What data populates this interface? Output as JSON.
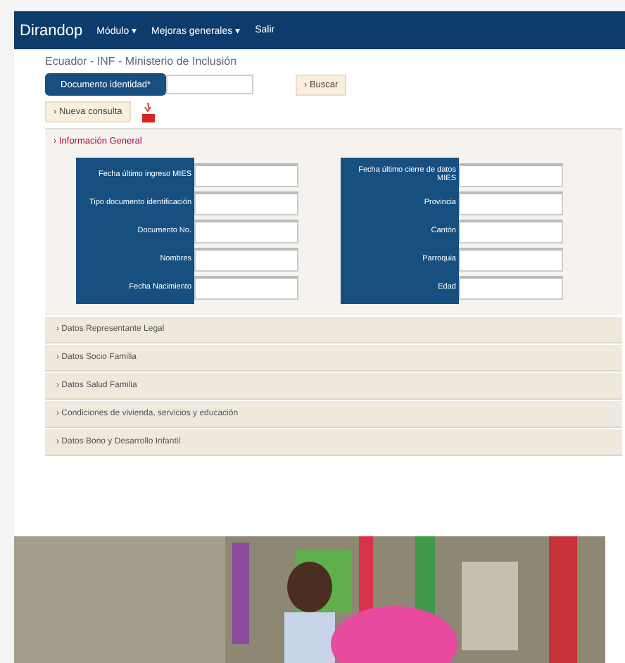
{
  "navbar": {
    "brand": "Dirandop",
    "menu": [
      {
        "label": "Módulo ▾"
      },
      {
        "label": "Mejoras generales ▾"
      },
      {
        "label": "Salir"
      }
    ]
  },
  "breadcrumb": "Ecuador - INF - Ministerio de Inclusión",
  "search": {
    "label": "Documento identidad*",
    "button": "› Buscar"
  },
  "new_query": "› Nueva consulta",
  "general": {
    "title": "› Información General",
    "expanded": true,
    "left_fields": [
      "Fecha último ingreso MIES",
      "Tipo documento identificación",
      "Documento No.",
      "Nombres",
      "Fecha Nacimiento"
    ],
    "right_fields": [
      "Fecha último cierre de datos MIES",
      "Provincia",
      "Cantón",
      "Parroquia",
      "Edad"
    ]
  },
  "sections": [
    {
      "title": "› Datos Representante Legal",
      "expanded": false
    },
    {
      "title": "› Datos Socio Familia",
      "expanded": false
    },
    {
      "title": "› Datos Salud Familia",
      "expanded": false
    },
    {
      "title": "› Condiciones de vivienda, servicios y educación",
      "expanded": false
    },
    {
      "title": "› Datos Bono y Desarrollo Infantil",
      "expanded": false
    }
  ]
}
